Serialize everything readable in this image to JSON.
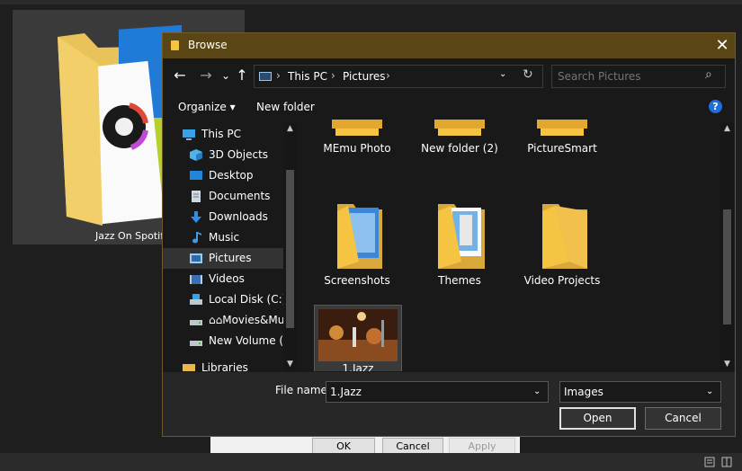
{
  "background": {
    "card_label": "Jazz On Spotify",
    "buttons": {
      "ok": "OK",
      "cancel": "Cancel",
      "apply": "Apply"
    }
  },
  "dialog": {
    "title": "Browse",
    "close_glyph": "✕",
    "nav": {
      "back_glyph": "←",
      "forward_glyph": "→",
      "recent_glyph": "⌄",
      "up_glyph": "↑"
    },
    "address": {
      "crumbs": [
        "This PC",
        "Pictures"
      ],
      "separator": "›",
      "dropdown_glyph": "⌄",
      "refresh_glyph": "↻"
    },
    "search": {
      "placeholder": "Search Pictures",
      "glyph": "⌕"
    },
    "toolbar": {
      "organize": "Organize ▾",
      "new_folder": "New folder",
      "help": "?"
    },
    "nav_pane": [
      {
        "label": "This PC",
        "icon": "computer-icon"
      },
      {
        "label": "3D Objects",
        "icon": "3d-objects-icon"
      },
      {
        "label": "Desktop",
        "icon": "desktop-icon"
      },
      {
        "label": "Documents",
        "icon": "documents-icon"
      },
      {
        "label": "Downloads",
        "icon": "downloads-icon"
      },
      {
        "label": "Music",
        "icon": "music-icon"
      },
      {
        "label": "Pictures",
        "icon": "pictures-icon",
        "selected": true
      },
      {
        "label": "Videos",
        "icon": "videos-icon"
      },
      {
        "label": "Local Disk (C:)",
        "icon": "drive-icon"
      },
      {
        "label": "⌂⌂Movies&Mu",
        "icon": "drive-icon"
      },
      {
        "label": "New Volume (F:)",
        "icon": "drive-icon"
      },
      {
        "label": "Libraries",
        "icon": "libraries-icon"
      }
    ],
    "items": [
      {
        "label": "MEmu Photo",
        "type": "folder"
      },
      {
        "label": "New folder (2)",
        "type": "folder"
      },
      {
        "label": "PictureSmart",
        "type": "folder"
      },
      {
        "label": "Screenshots",
        "type": "folder-preview"
      },
      {
        "label": "Themes",
        "type": "folder-preview"
      },
      {
        "label": "Video Projects",
        "type": "folder"
      },
      {
        "label": "1.Jazz",
        "type": "image",
        "selected": true
      }
    ],
    "file_name": {
      "label": "File name:",
      "value": "1.Jazz"
    },
    "file_type": {
      "value": "Images"
    },
    "buttons": {
      "open": "Open",
      "cancel": "Cancel"
    },
    "colors": {
      "titlebar": "#5a4614",
      "accent": "#1e6fd9",
      "folder": "#f5c443",
      "selection": "#3a3a3a"
    }
  }
}
